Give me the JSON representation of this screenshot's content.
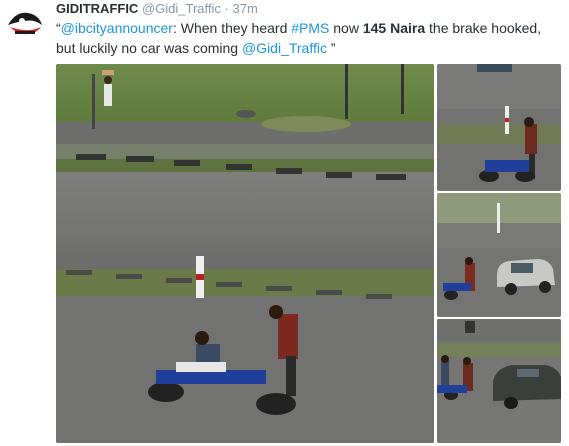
{
  "tweet": {
    "author_name": "GIDITRAFFIC",
    "author_handle": "@Gidi_Traffic",
    "separator": "·",
    "time": "37m",
    "text": {
      "open_quote": "“",
      "mention_1": "@ibcityannouncer",
      "part_1": ": When they heard ",
      "hashtag": "#PMS",
      "part_2": " now ",
      "price": "145 Naira",
      "part_3": " the brake hooked, but luckily no car was coming ",
      "mention_2": "@Gidi_Traffic",
      "close_quote": " ”"
    }
  },
  "colors": {
    "link": "#1b95e0",
    "text": "#292f33",
    "muted": "#8899a6"
  },
  "icons": {
    "avatar": "giditraffic-logo-icon"
  }
}
